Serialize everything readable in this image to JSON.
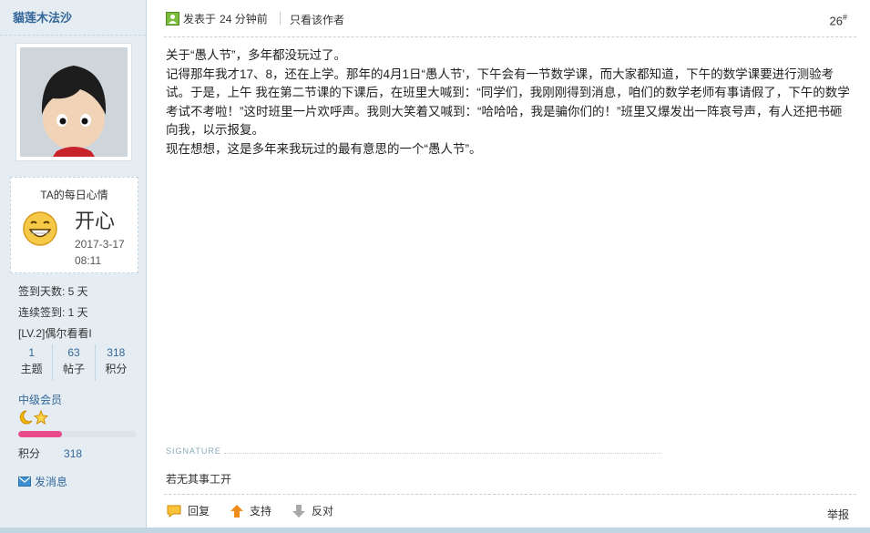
{
  "sidebar": {
    "author": "貓莲木法沙",
    "mood": {
      "title": "TA的每日心情",
      "text": "开心",
      "date": "2017-3-17",
      "time": "08:11"
    },
    "stats": {
      "checkin_days": "签到天数: 5 天",
      "streak": "连续签到: 1 天",
      "level": "[LV.2]偶尔看看I"
    },
    "counts": [
      {
        "num": "1",
        "label": "主题"
      },
      {
        "num": "63",
        "label": "帖子"
      },
      {
        "num": "318",
        "label": "积分"
      }
    ],
    "rank": "中级会员",
    "progress_fraction": 0.37,
    "points_label": "积分",
    "points_value": "318",
    "message_label": "发消息"
  },
  "post": {
    "posted_prefix": "发表于",
    "posted_time": "24 分钟前",
    "author_only": "只看该作者",
    "floor": "26",
    "floor_mark": "#",
    "paragraphs": [
      "关于“愚人节”，多年都没玩过了。",
      "记得那年我才17、8，还在上学。那年的4月1日“愚人节'，下午会有一节数学课，而大家都知道，下午的数学课要进行测验考试。于是，上午 我在第二节课的下课后，在班里大喊到：“同学们，我刚刚得到消息，咱们的数学老师有事请假了，下午的数学考试不考啦！”这时班里一片欢呼声。我则大笑着又喊到：“哈哈哈，我是骗你们的！”班里又爆发出一阵哀号声，有人还把书砸向我，以示报复。",
      "现在想想，这是多年来我玩过的最有意思的一个“愚人节”。"
    ],
    "signature_label": "SIGNATURE",
    "signature": "若无其事工开",
    "actions": {
      "reply": "回复",
      "support": "支持",
      "oppose": "反对",
      "report": "举报"
    }
  },
  "colors": {
    "sidebar_bg": "#e5edf2",
    "link": "#336699",
    "progress": "#e84a8b"
  }
}
